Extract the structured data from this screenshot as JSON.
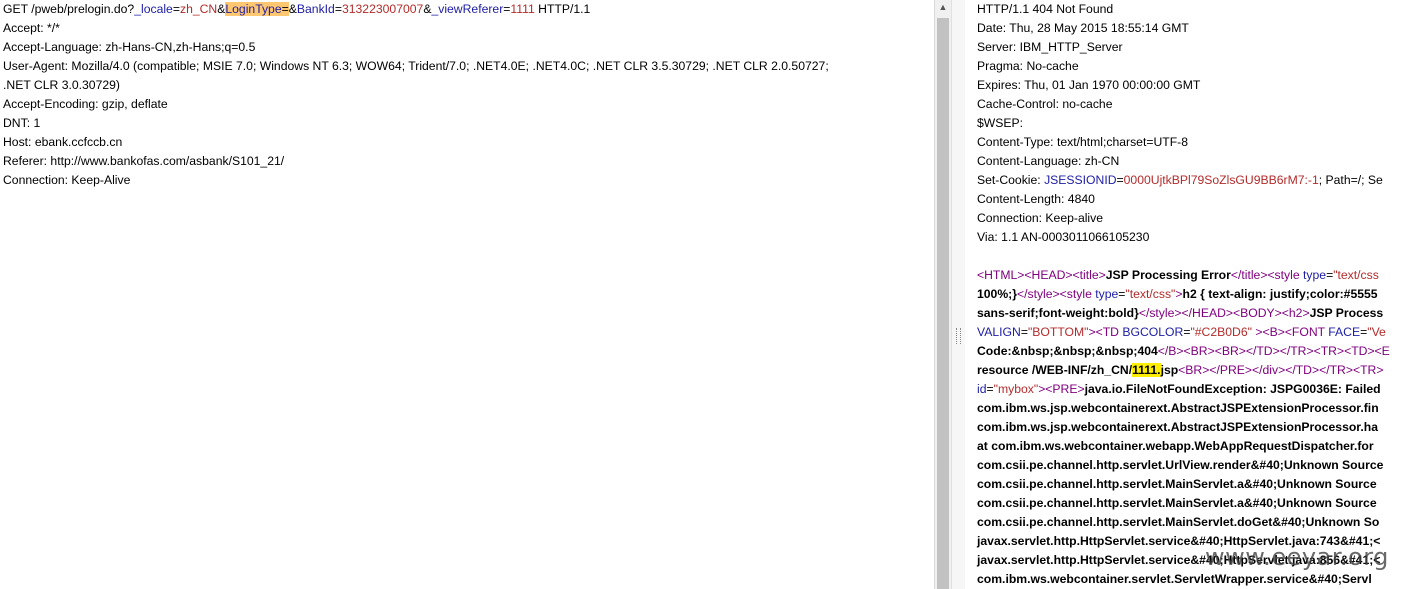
{
  "request": {
    "line1": {
      "prefix": "GET /pweb/prelogin.do?",
      "p1_name": "_locale",
      "eq1": "=",
      "p1_val": "zh_CN",
      "amp1": "&",
      "p2_name": "LoginType",
      "eq2": "=",
      "amp2": "&",
      "p3_name": "BankId",
      "eq3": "=",
      "p3_val": "313223007007",
      "amp3": "&",
      "p4_name": "_viewReferer",
      "eq4": "=",
      "p4_val": "1111",
      "suffix": " HTTP/1.1"
    },
    "accept": "Accept: */*",
    "accept_language": "Accept-Language: zh-Hans-CN,zh-Hans;q=0.5",
    "user_agent_1": "User-Agent: Mozilla/4.0 (compatible; MSIE 7.0; Windows NT 6.3; WOW64; Trident/7.0; .NET4.0E; .NET4.0C; .NET CLR 3.5.30729; .NET CLR 2.0.50727;",
    "user_agent_2": ".NET CLR 3.0.30729)",
    "accept_encoding": "Accept-Encoding: gzip, deflate",
    "dnt": "DNT: 1",
    "host": "Host: ebank.ccfccb.cn",
    "referer": "Referer: http://www.bankofas.com/asbank/S101_21/",
    "connection": "Connection: Keep-Alive"
  },
  "response": {
    "status": "HTTP/1.1 404 Not Found",
    "date": "Date: Thu, 28 May 2015 18:55:14 GMT",
    "server": "Server: IBM_HTTP_Server",
    "pragma": "Pragma: No-cache",
    "expires": "Expires: Thu, 01 Jan 1970 00:00:00 GMT",
    "cache_control": "Cache-Control: no-cache",
    "wsep": "$WSEP:",
    "content_type": "Content-Type: text/html;charset=UTF-8",
    "content_language": "Content-Language: zh-CN",
    "set_cookie_prefix": "Set-Cookie: ",
    "cookie_name": "JSESSIONID",
    "cookie_eq": "=",
    "cookie_val": "0000UjtkBPl79SoZlsGU9BB6rM7:-1",
    "cookie_suffix": "; Path=/; Se",
    "content_length": "Content-Length: 4840",
    "connection": "Connection: Keep-alive",
    "via": "Via: 1.1 AN-0003011066105230"
  },
  "body": {
    "l1": {
      "t1": "<HTML>",
      "t2": "<HEAD>",
      "t3": "<title>",
      "txt": "JSP Processing Error",
      "t4": "</title>",
      "t5": "<style ",
      "a1": "type",
      "eq": "=",
      "s1": "\"text/css"
    },
    "l2": {
      "txt1": "100%;}",
      "t1": "</style>",
      "t2": "<style ",
      "a1": "type",
      "eq": "=",
      "s1": "\"text/css\"",
      "t3": ">",
      "txt2": "h2 { text-align: justify;color:#5555"
    },
    "l3": {
      "txt1": "sans-serif;font-weight:bold}",
      "t1": "</style>",
      "t2": "</HEAD>",
      "t3": "<BODY>",
      "t4": "<h2>",
      "txt2": "JSP Process"
    },
    "l4": {
      "a1": "VALIGN",
      "eq1": "=",
      "s1": "\"BOTTOM\"",
      "t1": "><TD ",
      "a2": "BGCOLOR",
      "eq2": "=",
      "s2": "\"#C2B0D6\"",
      "t2": " ><B><FONT ",
      "a3": "FACE",
      "eq3": "=",
      "s3": "\"Ve"
    },
    "l5": {
      "txt1": "Code:&nbsp;&nbsp;&nbsp;404",
      "t1": "</B><BR><BR></TD></TR><TR><TD><E"
    },
    "l6": {
      "txt1": "resource /WEB-INF/zh_CN/",
      "hl": "1111.",
      "txt2": "jsp",
      "t1": "<BR></PRE></div></TD></TR><TR>"
    },
    "l7": {
      "a1": "id",
      "eq": "=",
      "s1": "\"mybox\"",
      "t1": "><PRE>",
      "txt": "java.io.FileNotFoundException: JSPG0036E: Failed"
    },
    "l8": "com.ibm.ws.jsp.webcontainerext.AbstractJSPExtensionProcessor.fin",
    "l9": "com.ibm.ws.jsp.webcontainerext.AbstractJSPExtensionProcessor.ha",
    "l10": "at com.ibm.ws.webcontainer.webapp.WebAppRequestDispatcher.for",
    "l11": "com.csii.pe.channel.http.servlet.UrlView.render&#40;Unknown Source",
    "l12": "com.csii.pe.channel.http.servlet.MainServlet.a&#40;Unknown Source",
    "l13": "com.csii.pe.channel.http.servlet.MainServlet.a&#40;Unknown Source",
    "l14": "com.csii.pe.channel.http.servlet.MainServlet.doGet&#40;Unknown So",
    "l15": "javax.servlet.http.HttpServlet.service&#40;HttpServlet.java:743&#41;<",
    "l16": "javax.servlet.http.HttpServlet.service&#40;HttpServlet.java:856&#41;<",
    "l17": "com.ibm.ws.webcontainer.servlet.ServletWrapper.service&#40;Servl"
  },
  "watermark": "www.eeyar.org",
  "colors": {
    "param": "#1d1da5",
    "value": "#b42b2b",
    "tag": "#800080",
    "highlight_orange": "#ffc770",
    "highlight_yellow": "#ffee00"
  }
}
